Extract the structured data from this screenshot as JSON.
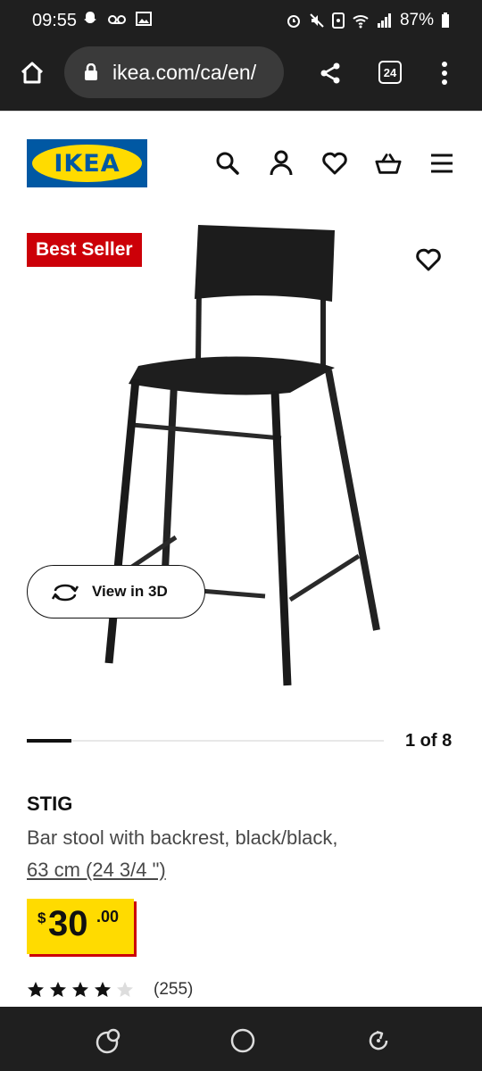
{
  "status": {
    "time": "09:55",
    "battery": "87%"
  },
  "browser": {
    "url": "ikea.com/ca/en/",
    "tab_count": "24"
  },
  "badge": "Best Seller",
  "view3d": "View in 3D",
  "carousel": {
    "counter": "1 of 8",
    "current": 1,
    "total": 8
  },
  "product": {
    "name": "STIG",
    "description": "Bar stool with backrest, black/black,",
    "size": "63 cm (24 3/4 \")",
    "price": {
      "currency": "$",
      "integer": "30",
      "decimal": ".00"
    },
    "rating": 4,
    "rating_max": 5,
    "rating_count": "(255)"
  },
  "colors": {
    "ikea_blue": "#0058a3",
    "ikea_yellow": "#ffdb00",
    "badge_red": "#cc0008"
  }
}
